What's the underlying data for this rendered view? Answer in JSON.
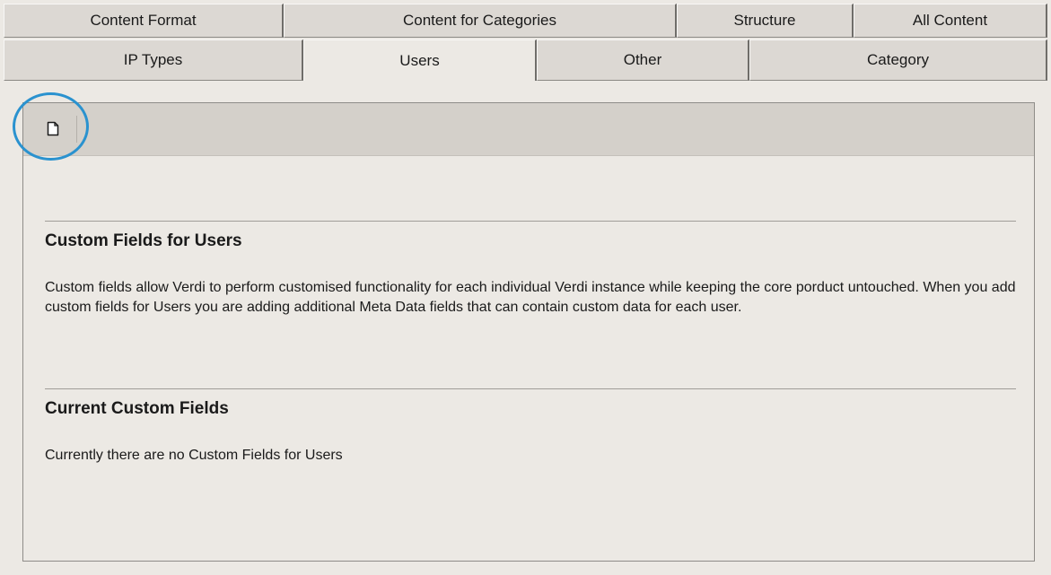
{
  "tabs": {
    "back_row": [
      {
        "label": "Content Format"
      },
      {
        "label": "Content for Categories"
      },
      {
        "label": "Structure"
      },
      {
        "label": "All Content"
      }
    ],
    "front_row": [
      {
        "label": "IP Types"
      },
      {
        "label": "Users"
      },
      {
        "label": "Other"
      },
      {
        "label": "Category"
      }
    ],
    "active": "Users"
  },
  "toolbar": {
    "new_icon": "new-document-icon"
  },
  "sections": {
    "custom_fields": {
      "title": "Custom Fields for Users",
      "body": "Custom fields allow Verdi to perform customised functionality for each individual Verdi instance while keeping the core porduct untouched. When you add custom fields for Users you are adding additional Meta Data fields that can contain custom data for each user."
    },
    "current_fields": {
      "title": "Current Custom Fields",
      "body": "Currently there are no Custom Fields for Users"
    }
  },
  "colors": {
    "highlight_ring": "#2a92cf",
    "toolbar_bg": "#d4d0ca",
    "page_bg": "#ece9e4"
  }
}
